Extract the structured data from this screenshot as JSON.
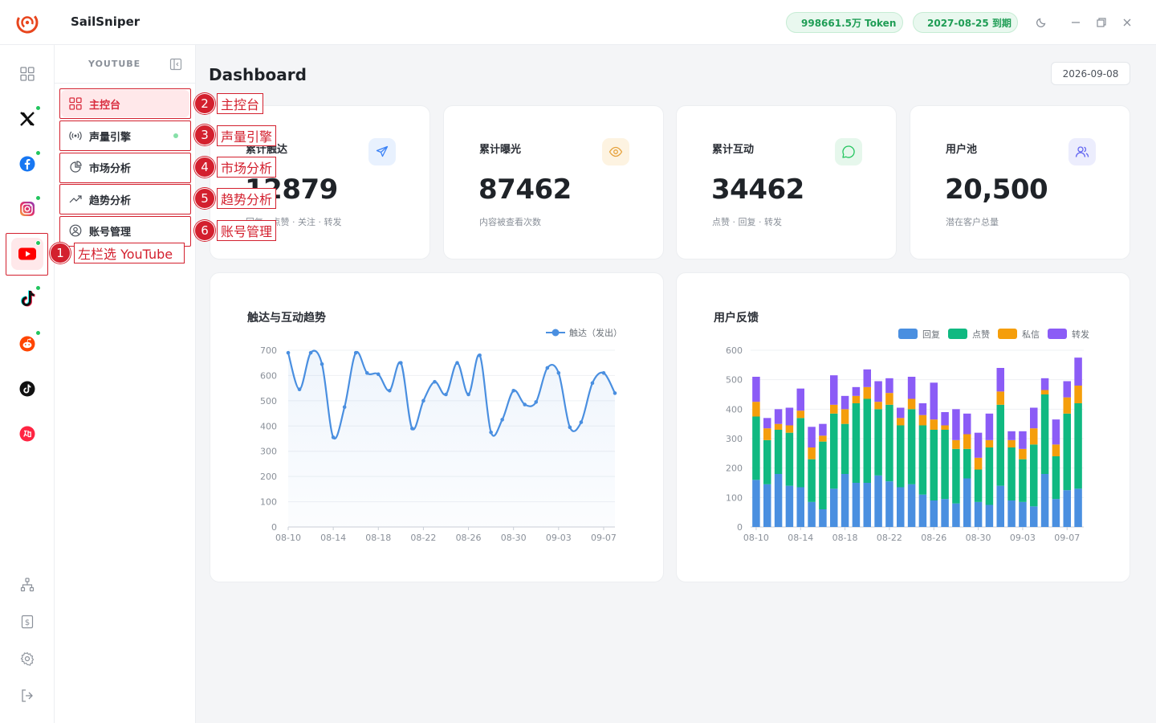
{
  "app": {
    "title": "SailSniper",
    "token_label": "998661.5万 Token",
    "expire_label": "2027-08-25 到期",
    "colors": {
      "accent": "#d92d3f",
      "green": "#1f9d55"
    }
  },
  "rail": {
    "platforms": [
      {
        "name": "dashboard-grid",
        "status": false
      },
      {
        "name": "x",
        "status": true
      },
      {
        "name": "facebook",
        "status": true
      },
      {
        "name": "instagram",
        "status": true
      },
      {
        "name": "youtube",
        "status": true,
        "active": true
      },
      {
        "name": "tiktok",
        "status": true
      },
      {
        "name": "reddit",
        "status": true
      },
      {
        "name": "tiktok-dark",
        "status": false
      },
      {
        "name": "xiaohongshu",
        "status": false
      }
    ],
    "bottom": [
      "sitemap-icon",
      "billing-icon",
      "settings-icon",
      "logout-icon"
    ]
  },
  "subnav": {
    "title": "YOUTUBE",
    "items": [
      {
        "label": "主控台",
        "icon": "grid-icon",
        "active": true
      },
      {
        "label": "声量引擎",
        "icon": "broadcast-icon",
        "dot": true
      },
      {
        "label": "市场分析",
        "icon": "pie-icon"
      },
      {
        "label": "趋势分析",
        "icon": "trend-icon"
      },
      {
        "label": "账号管理",
        "icon": "user-circle-icon"
      }
    ]
  },
  "annotations": [
    {
      "num": "1",
      "label": "左栏选 YouTube"
    },
    {
      "num": "2",
      "label": "主控台"
    },
    {
      "num": "3",
      "label": "声量引擎"
    },
    {
      "num": "4",
      "label": "市场分析"
    },
    {
      "num": "5",
      "label": "趋势分析"
    },
    {
      "num": "6",
      "label": "账号管理"
    }
  ],
  "main": {
    "title": "Dashboard",
    "date": "2026-09-08",
    "stats": [
      {
        "label": "累计触达",
        "value": "12879",
        "sub": "回复 · 点赞 · 关注 · 转发",
        "icon": "send-icon",
        "color": "#3b82f6",
        "bg": "#e8f1fe"
      },
      {
        "label": "累计曝光",
        "value": "87462",
        "sub": "内容被查看次数",
        "icon": "eye-icon",
        "color": "#e6a23c",
        "bg": "#fdf3e1"
      },
      {
        "label": "累计互动",
        "value": "34462",
        "sub": "点赞 · 回复 · 转发",
        "icon": "chat-icon",
        "color": "#22c55e",
        "bg": "#e6f7ec"
      },
      {
        "label": "用户池",
        "value": "20,500",
        "sub": "潜在客户总量",
        "icon": "users-icon",
        "color": "#6366f1",
        "bg": "#ecedfd"
      }
    ]
  },
  "chart_data": [
    {
      "type": "line",
      "title": "触达与互动趋势",
      "ylim": [
        0,
        700
      ],
      "yticks": [
        0,
        100,
        200,
        300,
        400,
        500,
        600,
        700
      ],
      "xtick_labels": [
        "08-10",
        "08-14",
        "08-18",
        "08-22",
        "08-26",
        "08-30",
        "09-03",
        "09-07"
      ],
      "x": [
        "08-10",
        "08-11",
        "08-12",
        "08-13",
        "08-14",
        "08-15",
        "08-16",
        "08-17",
        "08-18",
        "08-19",
        "08-20",
        "08-21",
        "08-22",
        "08-23",
        "08-24",
        "08-25",
        "08-26",
        "08-27",
        "08-28",
        "08-29",
        "08-30",
        "08-31",
        "09-01",
        "09-02",
        "09-03",
        "09-04",
        "09-05",
        "09-06",
        "09-07",
        "09-08"
      ],
      "series": [
        {
          "name": "触达（发出）",
          "color": "#4a8fe0",
          "values": [
            690,
            545,
            690,
            645,
            355,
            475,
            690,
            610,
            605,
            540,
            650,
            390,
            500,
            575,
            525,
            650,
            525,
            680,
            375,
            425,
            540,
            485,
            495,
            630,
            610,
            395,
            415,
            570,
            610,
            530
          ]
        }
      ]
    },
    {
      "type": "bar",
      "stacked": true,
      "title": "用户反馈",
      "ylim": [
        0,
        600
      ],
      "yticks": [
        0,
        100,
        200,
        300,
        400,
        500,
        600
      ],
      "xtick_labels": [
        "08-10",
        "08-14",
        "08-18",
        "08-22",
        "08-26",
        "08-30",
        "09-03",
        "09-07"
      ],
      "x": [
        "08-10",
        "08-11",
        "08-12",
        "08-13",
        "08-14",
        "08-15",
        "08-16",
        "08-17",
        "08-18",
        "08-19",
        "08-20",
        "08-21",
        "08-22",
        "08-23",
        "08-24",
        "08-25",
        "08-26",
        "08-27",
        "08-28",
        "08-29",
        "08-30",
        "08-31",
        "09-01",
        "09-02",
        "09-03",
        "09-04",
        "09-05",
        "09-06",
        "09-07",
        "09-08"
      ],
      "series": [
        {
          "name": "回复",
          "color": "#4a8fe0",
          "values": [
            160,
            145,
            180,
            140,
            135,
            85,
            60,
            130,
            180,
            150,
            150,
            175,
            155,
            135,
            145,
            110,
            90,
            95,
            80,
            165,
            85,
            75,
            140,
            90,
            85,
            70,
            180,
            95,
            125,
            130
          ]
        },
        {
          "name": "点赞",
          "color": "#10b981",
          "values": [
            215,
            150,
            150,
            180,
            235,
            145,
            230,
            255,
            170,
            270,
            285,
            225,
            260,
            210,
            255,
            235,
            240,
            235,
            185,
            100,
            110,
            195,
            275,
            180,
            145,
            210,
            270,
            145,
            260,
            290
          ]
        },
        {
          "name": "私信",
          "color": "#f59e0b",
          "values": [
            50,
            40,
            20,
            25,
            25,
            40,
            20,
            30,
            50,
            25,
            40,
            25,
            40,
            25,
            35,
            35,
            35,
            15,
            30,
            50,
            40,
            25,
            45,
            25,
            35,
            55,
            15,
            40,
            55,
            60
          ]
        },
        {
          "name": "转发",
          "color": "#8b5cf6",
          "values": [
            85,
            35,
            50,
            60,
            75,
            70,
            40,
            100,
            45,
            30,
            60,
            70,
            50,
            35,
            75,
            40,
            125,
            45,
            105,
            70,
            85,
            90,
            80,
            30,
            60,
            70,
            40,
            85,
            55,
            95
          ]
        }
      ]
    }
  ]
}
